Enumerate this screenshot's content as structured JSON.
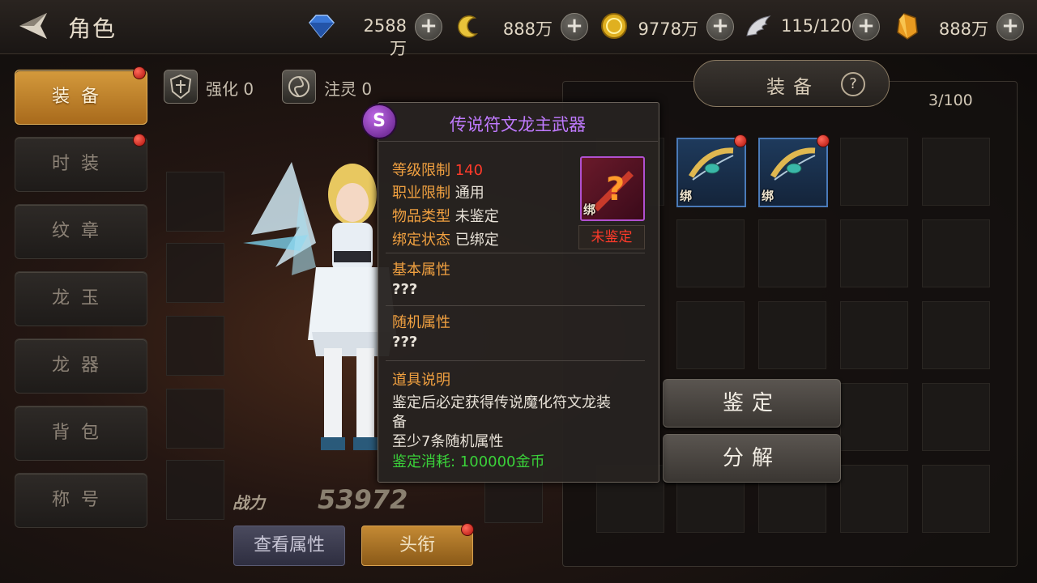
{
  "header": {
    "title": "角色",
    "currencies": [
      {
        "name": "diamond",
        "icon": "blue-diamond-icon",
        "value": "2588万"
      },
      {
        "name": "crescent",
        "icon": "crescent-icon",
        "value": "888万"
      },
      {
        "name": "gold",
        "icon": "gold-coin-icon",
        "value": "9778万"
      },
      {
        "name": "stamina",
        "icon": "wing-icon",
        "value": "115/120"
      },
      {
        "name": "crystal",
        "icon": "amber-crystal-icon",
        "value": "888万"
      }
    ]
  },
  "sidebar": {
    "items": [
      {
        "label": "装备",
        "active": true,
        "badge": true
      },
      {
        "label": "时装",
        "active": false,
        "badge": true
      },
      {
        "label": "纹章",
        "active": false,
        "badge": false
      },
      {
        "label": "龙玉",
        "active": false,
        "badge": false
      },
      {
        "label": "龙器",
        "active": false,
        "badge": false
      },
      {
        "label": "背包",
        "active": false,
        "badge": false
      },
      {
        "label": "称号",
        "active": false,
        "badge": false
      }
    ]
  },
  "upgrade": {
    "enhance_label": "强化 0",
    "infuse_label": "注灵 0"
  },
  "character": {
    "power_label": "战力",
    "power_value": "53972",
    "view_attrs": "查看属性",
    "title_button": "头衔"
  },
  "equip_panel": {
    "title": "装备",
    "capacity": "3/100",
    "bind_label": "绑",
    "identify_button": "鉴定",
    "decompose_button": "分解"
  },
  "tooltip": {
    "badge": "S",
    "name": "传说符文龙主武器",
    "level_key": "等级限制",
    "level_val": "140",
    "class_key": "职业限制",
    "class_val": "通用",
    "type_key": "物品类型",
    "type_val": "未鉴定",
    "bind_key": "绑定状态",
    "bind_val": "已绑定",
    "icon_bind": "绑",
    "unidentified_badge": "未鉴定",
    "base_attr_title": "基本属性",
    "base_attr_value": "???",
    "random_attr_title": "随机属性",
    "random_attr_value": "???",
    "desc_title": "道具说明",
    "desc_line1": "鉴定后必定获得传说魔化符文龙装",
    "desc_line2": "备",
    "desc_line3": "至少7条随机属性",
    "cost": "鉴定消耗: 100000金币"
  },
  "colors": {
    "accent_gold": "#d49a3c",
    "legendary_purple": "#c07aff",
    "warning_red": "#ff3a2a",
    "cost_green": "#3ad13a"
  }
}
